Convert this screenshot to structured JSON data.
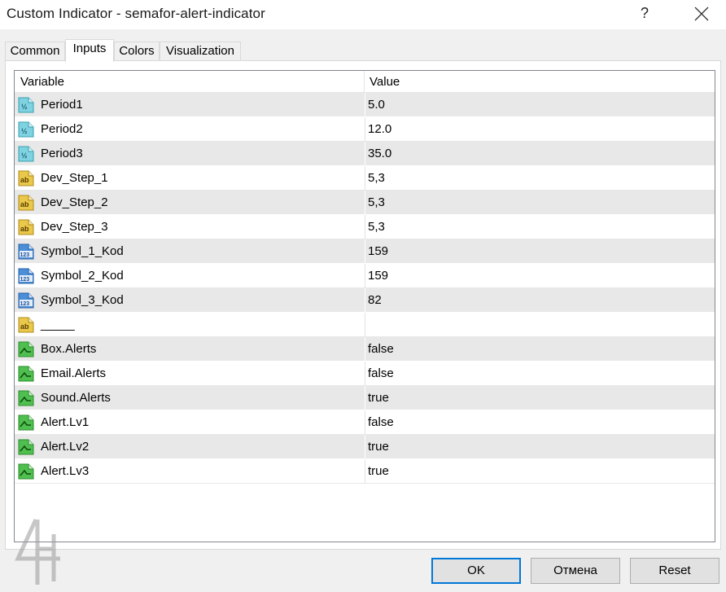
{
  "window": {
    "title": "Custom Indicator - semafor-alert-indicator",
    "help_label": "?"
  },
  "tabs": [
    {
      "label": "Common",
      "active": false
    },
    {
      "label": "Inputs",
      "active": true
    },
    {
      "label": "Colors",
      "active": false
    },
    {
      "label": "Visualization",
      "active": false
    }
  ],
  "grid": {
    "headers": {
      "variable": "Variable",
      "value": "Value"
    },
    "rows": [
      {
        "icon": "double-icon",
        "name": "Period1",
        "value": "5.0"
      },
      {
        "icon": "double-icon",
        "name": "Period2",
        "value": "12.0"
      },
      {
        "icon": "double-icon",
        "name": "Period3",
        "value": "35.0"
      },
      {
        "icon": "string-icon",
        "name": "Dev_Step_1",
        "value": "5,3"
      },
      {
        "icon": "string-icon",
        "name": "Dev_Step_2",
        "value": "5,3"
      },
      {
        "icon": "string-icon",
        "name": "Dev_Step_3",
        "value": "5,3"
      },
      {
        "icon": "integer-icon",
        "name": "Symbol_1_Kod",
        "value": "159"
      },
      {
        "icon": "integer-icon",
        "name": "Symbol_2_Kod",
        "value": "159"
      },
      {
        "icon": "integer-icon",
        "name": "Symbol_3_Kod",
        "value": "82"
      },
      {
        "icon": "string-icon",
        "name": "_____",
        "value": ""
      },
      {
        "icon": "bool-icon",
        "name": "Box.Alerts",
        "value": "false"
      },
      {
        "icon": "bool-icon",
        "name": "Email.Alerts",
        "value": "false"
      },
      {
        "icon": "bool-icon",
        "name": "Sound.Alerts",
        "value": "true"
      },
      {
        "icon": "bool-icon",
        "name": "Alert.Lv1",
        "value": "false"
      },
      {
        "icon": "bool-icon",
        "name": "Alert.Lv2",
        "value": "true"
      },
      {
        "icon": "bool-icon",
        "name": "Alert.Lv3",
        "value": "true"
      }
    ]
  },
  "buttons": {
    "ok": "OK",
    "cancel": "Отмена",
    "reset": "Reset"
  },
  "colors": {
    "accent": "#0078d7",
    "row_alt": "#e8e8e8",
    "double_icon": "#7fd3e0",
    "string_icon": "#e9c84a",
    "integer_icon": "#4a8fd8",
    "bool_icon": "#4fc04f"
  }
}
